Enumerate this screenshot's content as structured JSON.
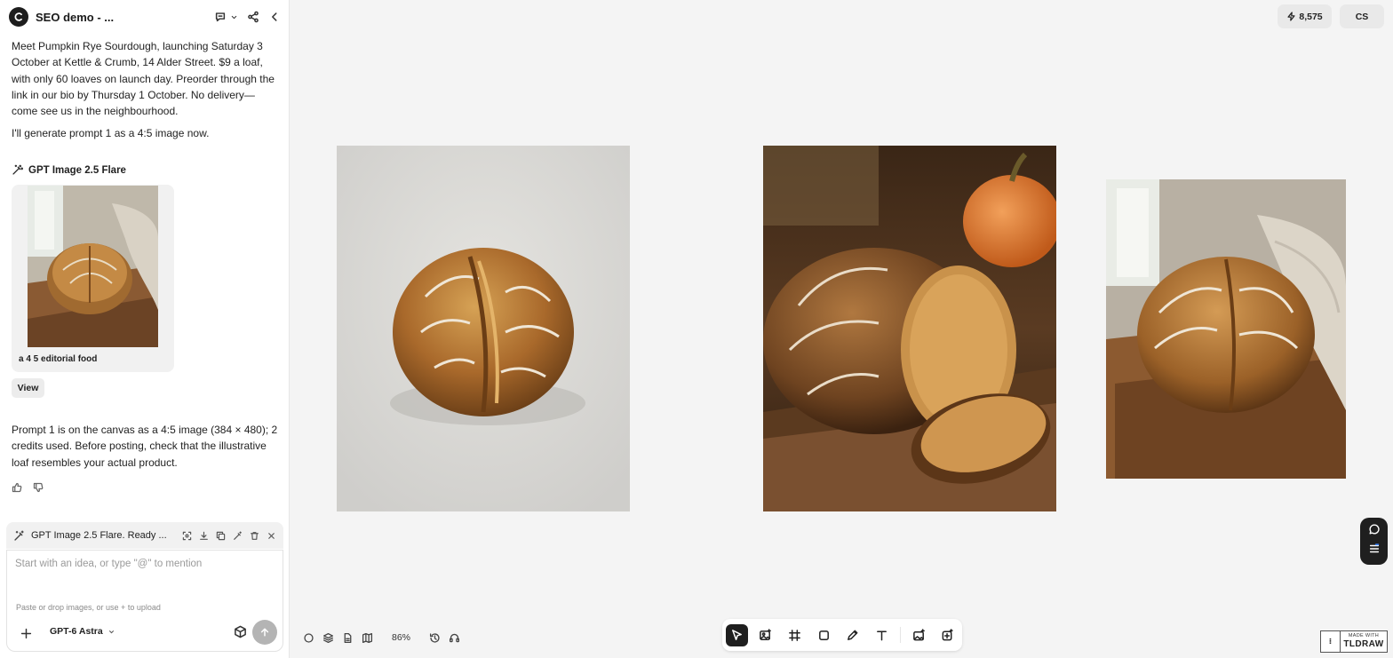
{
  "header": {
    "title": "SEO demo - ..."
  },
  "chat": {
    "message_1": "Meet Pumpkin Rye Sourdough, launching Saturday 3 October at Kettle & Crumb, 14 Alder Street. $9 a loaf, with only 60 loaves on launch day. Preorder through the link in our bio by Thursday 1 October. No delivery—come see us in the neighbourhood.",
    "message_2": "I'll generate prompt 1 as a 4:5 image now.",
    "tool_name": "GPT Image 2.5 Flare",
    "generation_caption": "a 4 5 editorial food",
    "view_label": "View",
    "message_3": "Prompt 1 is on the canvas as a 4:5 image (384 × 480); 2 credits used. Before posting, check that the illustrative loaf resembles your actual product."
  },
  "status_bar": {
    "text": "GPT Image 2.5 Flare. Ready ..."
  },
  "composer": {
    "placeholder": "Start with an idea, or type \"@\" to mention",
    "hint": "Paste or drop images, or use + to upload",
    "model": "GPT-6 Astra"
  },
  "topbar": {
    "credits": "8,575",
    "user_initials": "CS"
  },
  "canvas": {
    "zoom": "86%",
    "images": [
      {
        "subject": "sourdough loaf on grey surface"
      },
      {
        "subject": "sliced rye sourdough with pumpkin on wooden board"
      },
      {
        "subject": "sourdough loaf on board with linen cloth"
      }
    ]
  },
  "badge": {
    "made_with": "MADE WITH",
    "brand": "TLDRAW"
  },
  "colors": {
    "canvas_bg": "#f4f4f4",
    "dark": "#1f1f1f",
    "accent_blue": "#3b82f6"
  }
}
